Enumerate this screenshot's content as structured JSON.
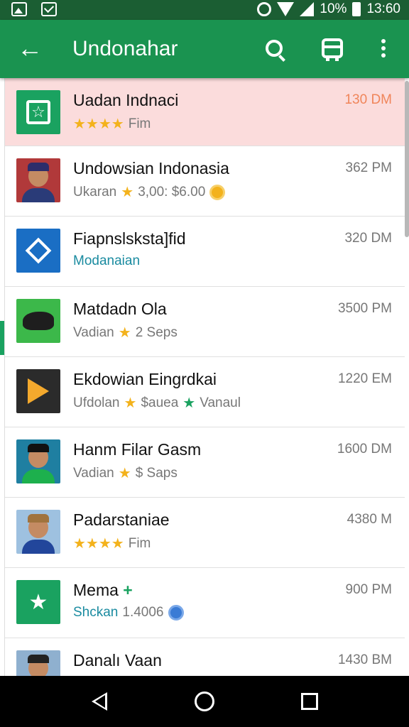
{
  "status_bar": {
    "battery_text": "10%",
    "time": "13:60",
    "icons": [
      "image-icon",
      "mail-icon",
      "alarm-icon",
      "wifi-icon",
      "signal-icon",
      "battery-icon"
    ]
  },
  "app_bar": {
    "title": "Undonahar",
    "back_icon": "arrow-left-icon",
    "actions": [
      "search-icon",
      "bus-icon",
      "more-vert-icon"
    ],
    "color": "#1a9350"
  },
  "items": [
    {
      "title": "Uadan Indnaci",
      "sub": "Fim",
      "stars": "★★★★",
      "time": "130 DM",
      "thumb": "star-app-icon",
      "highlight": true
    },
    {
      "title": "Undowsian Indonasia",
      "sub_a": "Ukaran",
      "star": "★",
      "sub_b": "3,00: $6.00",
      "time": "362 PM",
      "thumb": "person-avatar"
    },
    {
      "title": "Fiapnslsksta]fid",
      "sub": "Modanaian",
      "time": "320 DM",
      "thumb": "diamond-app-icon"
    },
    {
      "title": "Matdadn Ola",
      "sub_a": "Vadian",
      "star": "★",
      "sub_b": "2 Seps",
      "time": "3500 PM",
      "thumb": "creature-image"
    },
    {
      "title": "Ekdowian Eingrdkai",
      "sub_a": "Ufdolan",
      "star": "★",
      "sub_b": "$auea",
      "star2": "★",
      "sub_c": "Vanaul",
      "time": "1220 EM",
      "thumb": "play-store-icon"
    },
    {
      "title": "Hanm Filar Gasm",
      "sub_a": "Vadian",
      "star": "★",
      "sub_b": "$ Saps",
      "time": "1600 DM",
      "thumb": "person-avatar"
    },
    {
      "title": "Padarstaniae",
      "sub": "Fim",
      "stars": "★★★★",
      "time": "4380 M",
      "thumb": "person-avatar"
    },
    {
      "title": "Mema",
      "title_mark": "+",
      "sub_a": "Shckan",
      "sub_b": "1.4006",
      "time": "900 PM",
      "thumb": "star-app-icon"
    },
    {
      "title": "Danalı Vaan",
      "time": "1430 BM",
      "thumb": "person-avatar"
    }
  ],
  "nav_bar": {
    "icons": [
      "nav-back-icon",
      "nav-home-icon",
      "nav-recents-icon"
    ]
  },
  "colors": {
    "status_bar": "#1b5e33",
    "highlight_row": "#fbdcdc",
    "star": "#f3b21c",
    "accent_time": "#f0855a"
  }
}
